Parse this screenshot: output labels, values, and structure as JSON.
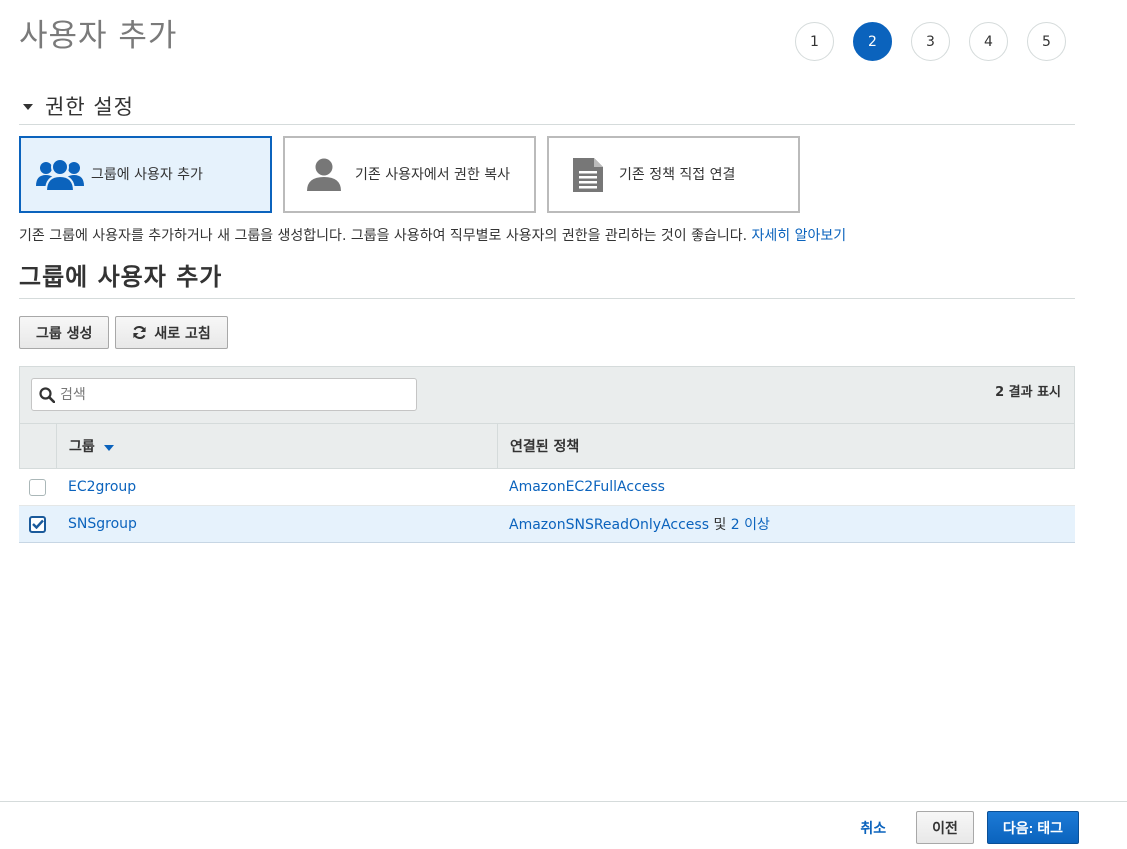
{
  "page": {
    "title": "사용자 추가"
  },
  "stepper": {
    "steps": [
      "1",
      "2",
      "3",
      "4",
      "5"
    ],
    "active": "2"
  },
  "permissions": {
    "section_label": "권한 설정",
    "options": [
      {
        "label": "그룹에 사용자 추가",
        "icon": "users-group-icon",
        "selected": true
      },
      {
        "label": "기존 사용자에서 권한 복사",
        "icon": "user-icon",
        "selected": false
      },
      {
        "label": "기존 정책 직접 연결",
        "icon": "document-icon",
        "selected": false
      }
    ],
    "description": "기존 그룹에 사용자를 추가하거나 새 그룹을 생성합니다. 그룹을 사용하여 직무별로 사용자의 권한을 관리하는 것이 좋습니다.",
    "learn_more": "자세히 알아보기"
  },
  "groups": {
    "title": "그룹에 사용자 추가",
    "create_button": "그룹 생성",
    "refresh_button": "새로 고침",
    "search_placeholder": "검색",
    "result_count": "2 결과 표시",
    "columns": {
      "group": "그룹",
      "policy": "연결된 정책"
    },
    "rows": [
      {
        "group": "EC2group",
        "policy": "AmazonEC2FullAccess",
        "extra_prefix": "",
        "extra_link": "",
        "checked": false
      },
      {
        "group": "SNSgroup",
        "policy": "AmazonSNSReadOnlyAccess",
        "extra_prefix": " 및 ",
        "extra_link": "2 이상",
        "checked": true
      }
    ]
  },
  "footer": {
    "cancel": "취소",
    "previous": "이전",
    "next": "다음: 태그"
  },
  "colors": {
    "accent": "#0b63bd",
    "selected_bg": "#e6f2fc",
    "header_bg": "#eaeded"
  }
}
